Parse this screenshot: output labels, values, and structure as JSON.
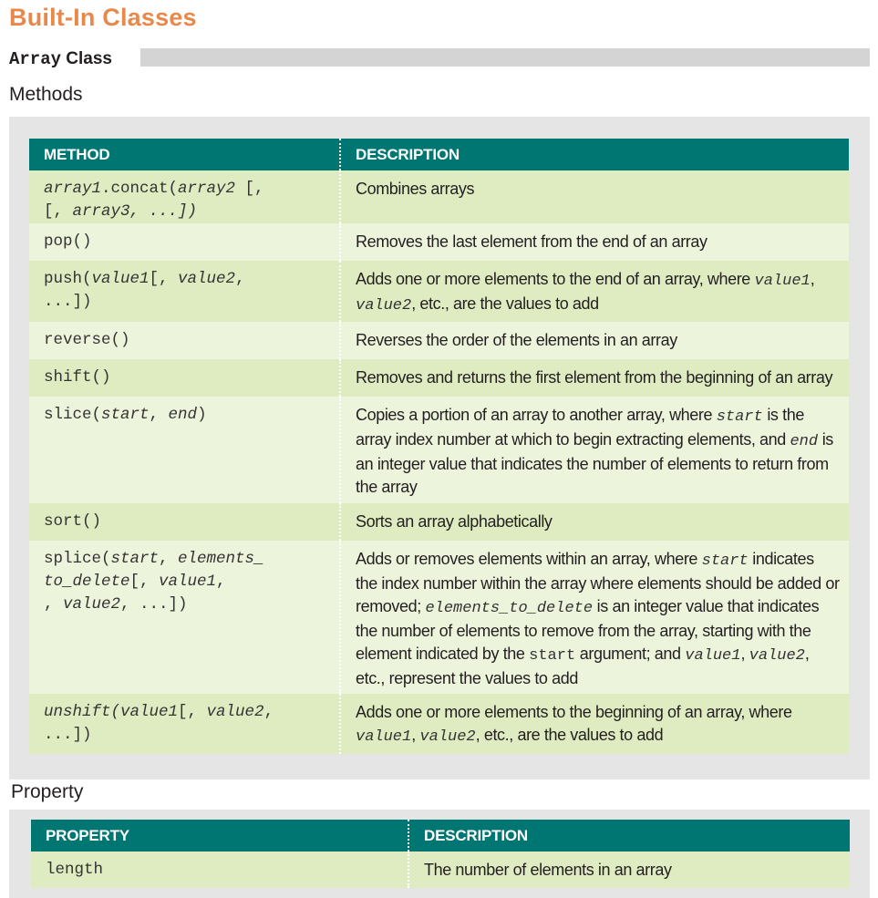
{
  "page_title": "Built-In Classes",
  "class_name": "Array",
  "class_suffix": "Class",
  "methods_label": "Methods",
  "property_label": "Property",
  "methods_table": {
    "headers": [
      "METHOD",
      "DESCRIPTION"
    ],
    "rows": [
      {
        "method": [
          {
            "t": "array1",
            "i": true
          },
          {
            "t": ".concat("
          },
          {
            "t": "array2",
            "i": true
          },
          {
            "t": "\n[, "
          },
          {
            "t": "array3",
            "i": true
          },
          {
            "t": ", ...])",
            "i": true
          }
        ],
        "desc": [
          {
            "t": "Combines arrays"
          }
        ]
      },
      {
        "method": [
          {
            "t": "pop()"
          }
        ],
        "desc": [
          {
            "t": "Removes the last element from the end of an array"
          }
        ]
      },
      {
        "method": [
          {
            "t": "push("
          },
          {
            "t": "value1",
            "i": true
          },
          {
            "t": "[, "
          },
          {
            "t": "value2",
            "i": true
          },
          {
            "t": ",\n...])"
          }
        ],
        "desc": [
          {
            "t": "Adds one or more elements to the end of an array, where "
          },
          {
            "t": "value1",
            "m": true,
            "i": true
          },
          {
            "t": ", "
          },
          {
            "t": "value2",
            "m": true,
            "i": true
          },
          {
            "t": ", etc., are the values to add"
          }
        ]
      },
      {
        "method": [
          {
            "t": "reverse()"
          }
        ],
        "desc": [
          {
            "t": "Reverses the order of the elements in an array"
          }
        ]
      },
      {
        "method": [
          {
            "t": "shift()"
          }
        ],
        "desc": [
          {
            "t": "Removes and returns the first element from the beginning of an array"
          }
        ]
      },
      {
        "method": [
          {
            "t": "slice("
          },
          {
            "t": "start",
            "i": true
          },
          {
            "t": ", "
          },
          {
            "t": "end",
            "i": true
          },
          {
            "t": ")"
          }
        ],
        "desc": [
          {
            "t": "Copies a portion of an array to another array, where "
          },
          {
            "t": "start",
            "m": true,
            "i": true
          },
          {
            "t": " is the array index number at which to begin extracting elements, and "
          },
          {
            "t": "end",
            "m": true,
            "i": true
          },
          {
            "t": " is an integer value that indicates the number of elements to return from the array"
          }
        ]
      },
      {
        "method": [
          {
            "t": "sort()"
          }
        ],
        "desc": [
          {
            "t": "Sorts an array alphabetically"
          }
        ]
      },
      {
        "method": [
          {
            "t": "splice("
          },
          {
            "t": "start",
            "i": true
          },
          {
            "t": ", "
          },
          {
            "t": "elements_\nto_delete",
            "i": true
          },
          {
            "t": "[, "
          },
          {
            "t": "value1",
            "i": true
          },
          {
            "t": ",\n"
          },
          {
            "t": "value2",
            "i": true
          },
          {
            "t": ", ...])"
          }
        ],
        "desc": [
          {
            "t": "Adds or removes elements within an array, where "
          },
          {
            "t": "start",
            "m": true,
            "i": true
          },
          {
            "t": " indicates the index number within the array where elements should be added or removed; "
          },
          {
            "t": "elements_to_delete",
            "m": true,
            "i": true
          },
          {
            "t": " is an integer value that indicates the number of elements to remove from the array, starting with the element indicated by the "
          },
          {
            "t": "start",
            "m": true
          },
          {
            "t": " argument; and "
          },
          {
            "t": "value1",
            "m": true,
            "i": true
          },
          {
            "t": ", "
          },
          {
            "t": "value2",
            "m": true,
            "i": true
          },
          {
            "t": ", etc., represent the values to add"
          }
        ]
      },
      {
        "method": [
          {
            "t": "unshift(",
            "i": true
          },
          {
            "t": "value1",
            "i": true
          },
          {
            "t": "[, "
          },
          {
            "t": "value2",
            "i": true
          },
          {
            "t": ",\n...])"
          }
        ],
        "desc": [
          {
            "t": "Adds one or more elements to the beginning of an array, where "
          },
          {
            "t": "value1",
            "m": true,
            "i": true
          },
          {
            "t": ", "
          },
          {
            "t": "value2",
            "m": true,
            "i": true
          },
          {
            "t": ", etc., are the values to add"
          }
        ]
      }
    ]
  },
  "property_table": {
    "headers": [
      "PROPERTY",
      "DESCRIPTION"
    ],
    "rows": [
      {
        "property": "length",
        "desc": "The number of elements in an array"
      }
    ]
  }
}
